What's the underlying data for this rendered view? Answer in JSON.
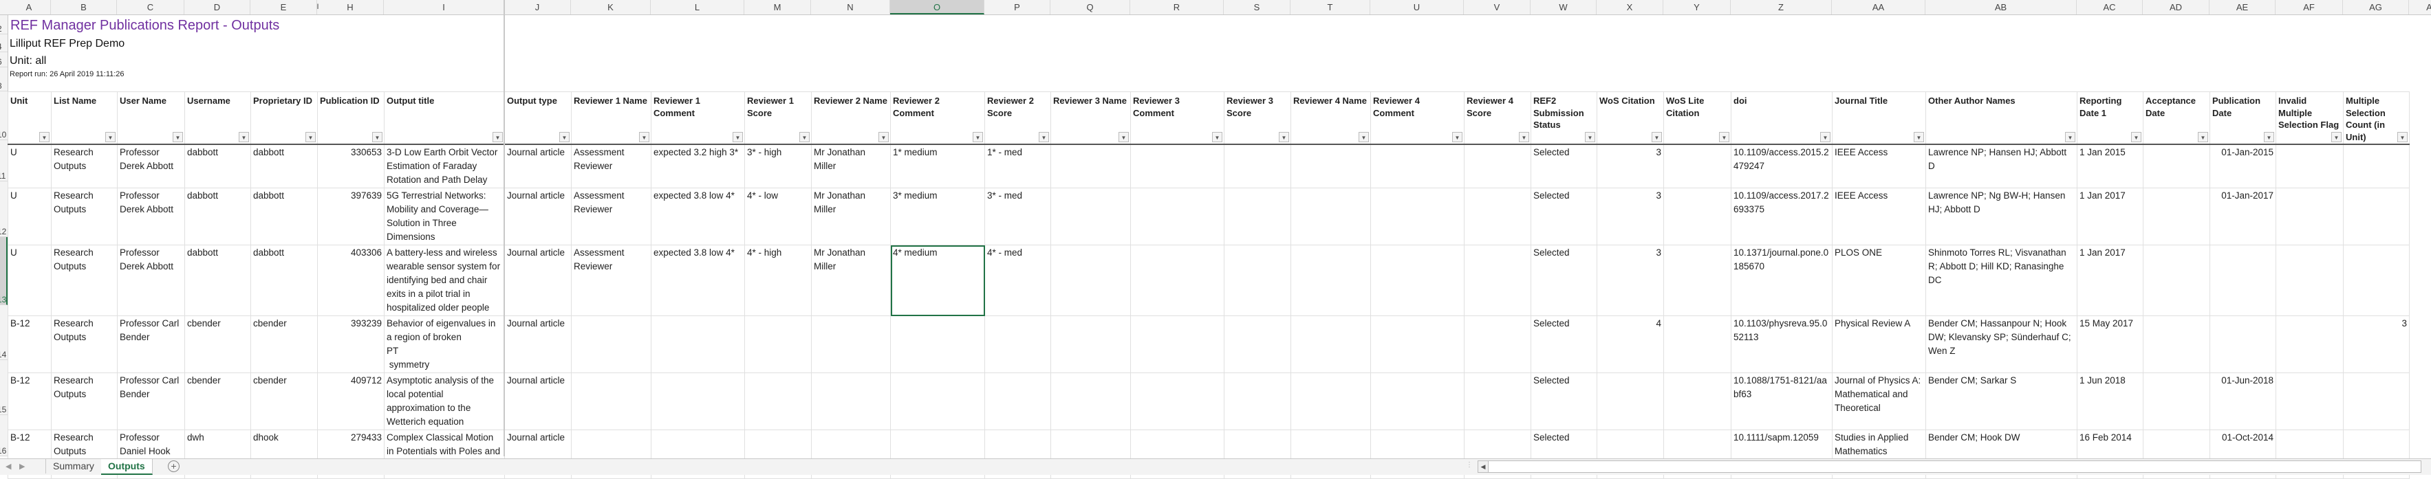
{
  "column_letters": [
    "A",
    "B",
    "C",
    "D",
    "E",
    "H",
    "I",
    "J",
    "K",
    "L",
    "M",
    "N",
    "O",
    "P",
    "Q",
    "R",
    "S",
    "T",
    "U",
    "V",
    "W",
    "X",
    "Y",
    "Z",
    "AA",
    "AB",
    "AC",
    "AD",
    "AE",
    "AF",
    "AG",
    "A"
  ],
  "hidden_col_marker": "I",
  "selected_column": "O",
  "row_numbers": {
    "title": [
      "2",
      "4",
      "6",
      "8"
    ],
    "header": "10",
    "data": [
      "11",
      "12",
      "13",
      "14",
      "15",
      "16"
    ]
  },
  "report": {
    "title": "REF Manager Publications Report - Outputs",
    "organisation": "Lilliput REF Prep Demo",
    "unit": "Unit: all",
    "report_run": "Report run: 26 April 2019 11:11:26"
  },
  "columns": [
    "Unit",
    "List Name",
    "User Name",
    "Username",
    "Proprietary ID",
    "Publication ID",
    "Output title",
    "Output type",
    "Reviewer 1 Name",
    "Reviewer 1 Comment",
    "Reviewer 1 Score",
    "Reviewer 2 Name",
    "Reviewer 2 Comment",
    "Reviewer 2 Score",
    "Reviewer 3 Name",
    "Reviewer 3 Comment",
    "Reviewer 3 Score",
    "Reviewer 4 Name",
    "Reviewer 4 Comment",
    "Reviewer 4 Score",
    "REF2 Submission Status",
    "WoS Citation",
    "WoS Lite Citation",
    "doi",
    "Journal Title",
    "Other Author Names",
    "Reporting Date 1",
    "Acceptance Date",
    "Publication Date",
    "Invalid Multiple Selection Flag",
    "Multiple Selection Count (in Unit)"
  ],
  "rows": [
    [
      "U",
      "Research Outputs",
      "Professor Derek Abbott",
      "dabbott",
      "dabbott",
      "330653",
      "3-D Low Earth Orbit Vector Estimation of Faraday Rotation and Path Delay",
      "Journal article",
      "Assessment Reviewer",
      "expected 3.2   high 3*",
      "3* - high",
      "Mr Jonathan Miller",
      "1* medium",
      "1* - med",
      "",
      "",
      "",
      "",
      "",
      "",
      "Selected",
      "3",
      "",
      "10.1109/access.2015.2479247",
      "IEEE Access",
      "Lawrence NP; Hansen HJ; Abbott D",
      "1 Jan 2015",
      "",
      "01-Jan-2015",
      "",
      ""
    ],
    [
      "U",
      "Research Outputs",
      "Professor Derek Abbott",
      "dabbott",
      "dabbott",
      "397639",
      "5G Terrestrial Networks: Mobility and Coverage—Solution in Three Dimensions",
      "Journal article",
      "Assessment Reviewer",
      "expected 3.8 low 4*",
      "4* - low",
      "Mr Jonathan Miller",
      "3*  medium",
      "3* - med",
      "",
      "",
      "",
      "",
      "",
      "",
      "Selected",
      "3",
      "",
      "10.1109/access.2017.2693375",
      "IEEE Access",
      "Lawrence NP; Ng BW-H; Hansen HJ; Abbott D",
      "1 Jan 2017",
      "",
      "01-Jan-2017",
      "",
      ""
    ],
    [
      "U",
      "Research Outputs",
      "Professor Derek Abbott",
      "dabbott",
      "dabbott",
      "403306",
      "A battery-less and wireless wearable sensor system for identifying bed and chair exits in a pilot trial in hospitalized older people",
      "Journal article",
      "Assessment Reviewer",
      "expected 3.8 low 4*",
      "4* - high",
      "Mr Jonathan Miller",
      "4* medium",
      "4* - med",
      "",
      "",
      "",
      "",
      "",
      "",
      "Selected",
      "3",
      "",
      "10.1371/journal.pone.0185670",
      "PLOS ONE",
      "Shinmoto Torres RL; Visvanathan R; Abbott D; Hill KD; Ranasinghe DC",
      "1 Jan 2017",
      "",
      "",
      "",
      ""
    ],
    [
      "B-12",
      "Research Outputs",
      "Professor Carl Bender",
      "cbender",
      "cbender",
      "393239",
      "Behavior of eigenvalues in a region of broken\nPT\n symmetry",
      "Journal article",
      "",
      "",
      "",
      "",
      "",
      "",
      "",
      "",
      "",
      "",
      "",
      "",
      "Selected",
      "4",
      "",
      "10.1103/physreva.95.052113",
      "Physical Review A",
      "Bender CM; Hassanpour N; Hook DW; Klevansky SP; Sünderhauf C; Wen Z",
      "15 May 2017",
      "",
      "",
      "",
      "3"
    ],
    [
      "B-12",
      "Research Outputs",
      "Professor Carl Bender",
      "cbender",
      "cbender",
      "409712",
      "Asymptotic analysis of the local potential approximation to the Wetterich equation",
      "Journal article",
      "",
      "",
      "",
      "",
      "",
      "",
      "",
      "",
      "",
      "",
      "",
      "",
      "Selected",
      "",
      "",
      "10.1088/1751-8121/aabf63",
      "Journal of Physics A: Mathematical and Theoretical",
      "Bender CM; Sarkar S",
      "1 Jun 2018",
      "",
      "01-Jun-2018",
      "",
      ""
    ],
    [
      "B-12",
      "Research Outputs",
      "Professor Daniel Hook",
      "dwh",
      "dhook",
      "279433",
      "Complex Classical Motion in Potentials with Poles and Turning Points",
      "Journal article",
      "",
      "",
      "",
      "",
      "",
      "",
      "",
      "",
      "",
      "",
      "",
      "",
      "Selected",
      "",
      "",
      "10.1111/sapm.12059",
      "Studies in Applied Mathematics",
      "Bender CM; Hook DW",
      "16 Feb 2014",
      "",
      "01-Oct-2014",
      "",
      ""
    ]
  ],
  "selected_cell": {
    "row": 2,
    "col": 12
  },
  "sheet_tabs": [
    {
      "label": "Summary",
      "active": false
    },
    {
      "label": "Outputs",
      "active": true
    }
  ],
  "add_sheet_icon": "+",
  "colors": {
    "title": "#7030a0",
    "accent": "#217346"
  }
}
